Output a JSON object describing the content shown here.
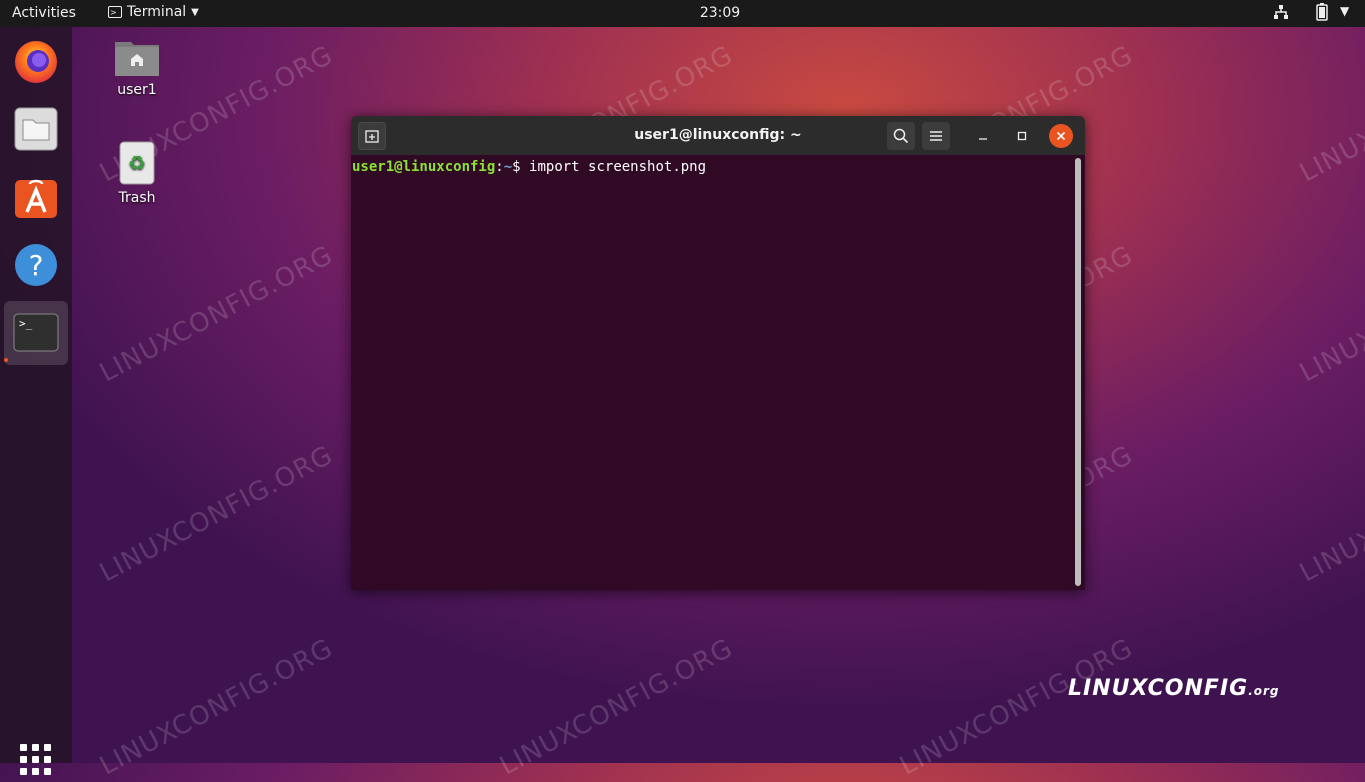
{
  "topbar": {
    "activities": "Activities",
    "app_menu": "Terminal",
    "clock": "23:09"
  },
  "dock": {
    "items": [
      "firefox",
      "files",
      "ubuntu-software",
      "help",
      "terminal"
    ],
    "show_apps": "show-applications"
  },
  "desktop": {
    "icons": [
      {
        "label": "user1"
      },
      {
        "label": "Trash"
      }
    ],
    "watermark": "LINUXCONFIG.ORG",
    "logo_main": "LINUXCONFIG",
    "logo_suffix": ".org"
  },
  "terminal": {
    "title": "user1@linuxconfig: ~",
    "prompt_user": "user1@linuxconfig",
    "prompt_sep": ":",
    "prompt_path": "~",
    "prompt_symbol": "$ ",
    "command": "import screenshot.png"
  },
  "colors": {
    "accent": "#e95420",
    "terminal_bg": "#300a24",
    "prompt_user": "#8ae234",
    "prompt_path": "#729fcf"
  }
}
